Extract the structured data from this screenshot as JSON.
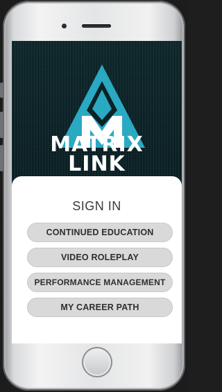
{
  "brand": {
    "line1": "MATRIX",
    "line2": "LINK",
    "accent_color": "#2aa9c2",
    "logo_icon": "triangle-m-logo-icon"
  },
  "panel": {
    "title": "SIGN IN",
    "buttons": [
      {
        "label": "CONTINUED EDUCATION"
      },
      {
        "label": "VIDEO ROLEPLAY"
      },
      {
        "label": "PERFORMANCE MANAGEMENT"
      },
      {
        "label": "MY CAREER PATH"
      }
    ]
  },
  "device": {
    "home_button_icon": "home-button-icon",
    "speaker_icon": "speaker-icon",
    "camera_icon": "camera-icon"
  }
}
